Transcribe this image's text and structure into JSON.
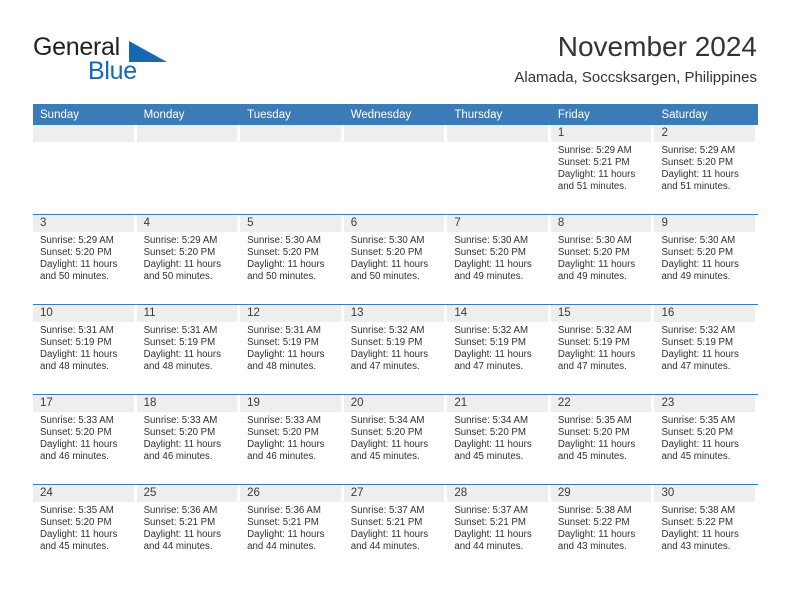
{
  "brand": {
    "word1": "General",
    "word2": "Blue",
    "triangle_color": "#1668b3"
  },
  "header": {
    "title": "November 2024",
    "subtitle": "Alamada, Soccsksargen, Philippines"
  },
  "theme": {
    "header_blue": "#3b7cb8",
    "daynum_bg": "#eeeeee",
    "text": "#303030"
  },
  "weekdays": [
    "Sunday",
    "Monday",
    "Tuesday",
    "Wednesday",
    "Thursday",
    "Friday",
    "Saturday"
  ],
  "weeks": [
    [
      {
        "day": "",
        "empty": true
      },
      {
        "day": "",
        "empty": true
      },
      {
        "day": "",
        "empty": true
      },
      {
        "day": "",
        "empty": true
      },
      {
        "day": "",
        "empty": true
      },
      {
        "day": "1",
        "sunrise": "Sunrise: 5:29 AM",
        "sunset": "Sunset: 5:21 PM",
        "daylight1": "Daylight: 11 hours",
        "daylight2": "and 51 minutes."
      },
      {
        "day": "2",
        "sunrise": "Sunrise: 5:29 AM",
        "sunset": "Sunset: 5:20 PM",
        "daylight1": "Daylight: 11 hours",
        "daylight2": "and 51 minutes."
      }
    ],
    [
      {
        "day": "3",
        "sunrise": "Sunrise: 5:29 AM",
        "sunset": "Sunset: 5:20 PM",
        "daylight1": "Daylight: 11 hours",
        "daylight2": "and 50 minutes."
      },
      {
        "day": "4",
        "sunrise": "Sunrise: 5:29 AM",
        "sunset": "Sunset: 5:20 PM",
        "daylight1": "Daylight: 11 hours",
        "daylight2": "and 50 minutes."
      },
      {
        "day": "5",
        "sunrise": "Sunrise: 5:30 AM",
        "sunset": "Sunset: 5:20 PM",
        "daylight1": "Daylight: 11 hours",
        "daylight2": "and 50 minutes."
      },
      {
        "day": "6",
        "sunrise": "Sunrise: 5:30 AM",
        "sunset": "Sunset: 5:20 PM",
        "daylight1": "Daylight: 11 hours",
        "daylight2": "and 50 minutes."
      },
      {
        "day": "7",
        "sunrise": "Sunrise: 5:30 AM",
        "sunset": "Sunset: 5:20 PM",
        "daylight1": "Daylight: 11 hours",
        "daylight2": "and 49 minutes."
      },
      {
        "day": "8",
        "sunrise": "Sunrise: 5:30 AM",
        "sunset": "Sunset: 5:20 PM",
        "daylight1": "Daylight: 11 hours",
        "daylight2": "and 49 minutes."
      },
      {
        "day": "9",
        "sunrise": "Sunrise: 5:30 AM",
        "sunset": "Sunset: 5:20 PM",
        "daylight1": "Daylight: 11 hours",
        "daylight2": "and 49 minutes."
      }
    ],
    [
      {
        "day": "10",
        "sunrise": "Sunrise: 5:31 AM",
        "sunset": "Sunset: 5:19 PM",
        "daylight1": "Daylight: 11 hours",
        "daylight2": "and 48 minutes."
      },
      {
        "day": "11",
        "sunrise": "Sunrise: 5:31 AM",
        "sunset": "Sunset: 5:19 PM",
        "daylight1": "Daylight: 11 hours",
        "daylight2": "and 48 minutes."
      },
      {
        "day": "12",
        "sunrise": "Sunrise: 5:31 AM",
        "sunset": "Sunset: 5:19 PM",
        "daylight1": "Daylight: 11 hours",
        "daylight2": "and 48 minutes."
      },
      {
        "day": "13",
        "sunrise": "Sunrise: 5:32 AM",
        "sunset": "Sunset: 5:19 PM",
        "daylight1": "Daylight: 11 hours",
        "daylight2": "and 47 minutes."
      },
      {
        "day": "14",
        "sunrise": "Sunrise: 5:32 AM",
        "sunset": "Sunset: 5:19 PM",
        "daylight1": "Daylight: 11 hours",
        "daylight2": "and 47 minutes."
      },
      {
        "day": "15",
        "sunrise": "Sunrise: 5:32 AM",
        "sunset": "Sunset: 5:19 PM",
        "daylight1": "Daylight: 11 hours",
        "daylight2": "and 47 minutes."
      },
      {
        "day": "16",
        "sunrise": "Sunrise: 5:32 AM",
        "sunset": "Sunset: 5:19 PM",
        "daylight1": "Daylight: 11 hours",
        "daylight2": "and 47 minutes."
      }
    ],
    [
      {
        "day": "17",
        "sunrise": "Sunrise: 5:33 AM",
        "sunset": "Sunset: 5:20 PM",
        "daylight1": "Daylight: 11 hours",
        "daylight2": "and 46 minutes."
      },
      {
        "day": "18",
        "sunrise": "Sunrise: 5:33 AM",
        "sunset": "Sunset: 5:20 PM",
        "daylight1": "Daylight: 11 hours",
        "daylight2": "and 46 minutes."
      },
      {
        "day": "19",
        "sunrise": "Sunrise: 5:33 AM",
        "sunset": "Sunset: 5:20 PM",
        "daylight1": "Daylight: 11 hours",
        "daylight2": "and 46 minutes."
      },
      {
        "day": "20",
        "sunrise": "Sunrise: 5:34 AM",
        "sunset": "Sunset: 5:20 PM",
        "daylight1": "Daylight: 11 hours",
        "daylight2": "and 45 minutes."
      },
      {
        "day": "21",
        "sunrise": "Sunrise: 5:34 AM",
        "sunset": "Sunset: 5:20 PM",
        "daylight1": "Daylight: 11 hours",
        "daylight2": "and 45 minutes."
      },
      {
        "day": "22",
        "sunrise": "Sunrise: 5:35 AM",
        "sunset": "Sunset: 5:20 PM",
        "daylight1": "Daylight: 11 hours",
        "daylight2": "and 45 minutes."
      },
      {
        "day": "23",
        "sunrise": "Sunrise: 5:35 AM",
        "sunset": "Sunset: 5:20 PM",
        "daylight1": "Daylight: 11 hours",
        "daylight2": "and 45 minutes."
      }
    ],
    [
      {
        "day": "24",
        "sunrise": "Sunrise: 5:35 AM",
        "sunset": "Sunset: 5:20 PM",
        "daylight1": "Daylight: 11 hours",
        "daylight2": "and 45 minutes."
      },
      {
        "day": "25",
        "sunrise": "Sunrise: 5:36 AM",
        "sunset": "Sunset: 5:21 PM",
        "daylight1": "Daylight: 11 hours",
        "daylight2": "and 44 minutes."
      },
      {
        "day": "26",
        "sunrise": "Sunrise: 5:36 AM",
        "sunset": "Sunset: 5:21 PM",
        "daylight1": "Daylight: 11 hours",
        "daylight2": "and 44 minutes."
      },
      {
        "day": "27",
        "sunrise": "Sunrise: 5:37 AM",
        "sunset": "Sunset: 5:21 PM",
        "daylight1": "Daylight: 11 hours",
        "daylight2": "and 44 minutes."
      },
      {
        "day": "28",
        "sunrise": "Sunrise: 5:37 AM",
        "sunset": "Sunset: 5:21 PM",
        "daylight1": "Daylight: 11 hours",
        "daylight2": "and 44 minutes."
      },
      {
        "day": "29",
        "sunrise": "Sunrise: 5:38 AM",
        "sunset": "Sunset: 5:22 PM",
        "daylight1": "Daylight: 11 hours",
        "daylight2": "and 43 minutes."
      },
      {
        "day": "30",
        "sunrise": "Sunrise: 5:38 AM",
        "sunset": "Sunset: 5:22 PM",
        "daylight1": "Daylight: 11 hours",
        "daylight2": "and 43 minutes."
      }
    ]
  ]
}
